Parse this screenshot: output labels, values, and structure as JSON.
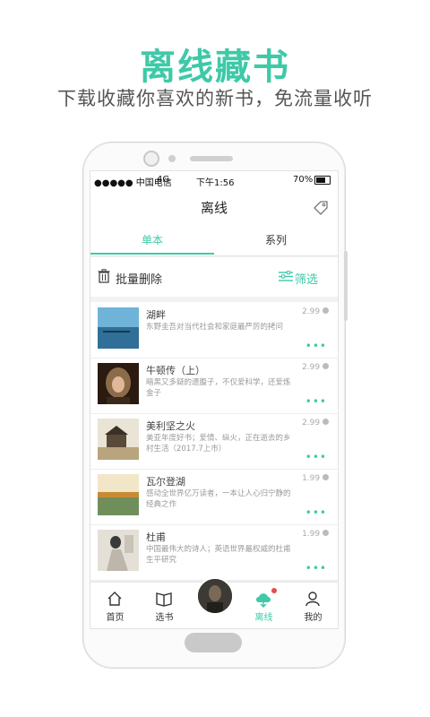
{
  "promo": {
    "title": "离线藏书",
    "subtitle": "下载收藏你喜欢的新书，免流量收听"
  },
  "status_bar": {
    "carrier": "●●●●● 中国电信",
    "network": "4G",
    "time": "下午1:56",
    "battery": "70%"
  },
  "app_bar": {
    "title": "离线",
    "tag_icon": "tag-icon"
  },
  "tabs": [
    {
      "label": "单本",
      "active": true
    },
    {
      "label": "系列",
      "active": false
    }
  ],
  "toolbar": {
    "batch_delete_label": "批量删除",
    "filter_label": "筛选"
  },
  "books": [
    {
      "title": "湖畔",
      "desc": "东野圭吾对当代社会和家庭最严厉的拷问",
      "price": "2.99"
    },
    {
      "title": "牛顿传（上）",
      "desc": "暗黑又多疑的遗腹子，不仅爱科学，还爱炼金子",
      "price": "2.99"
    },
    {
      "title": "美利坚之火",
      "desc": "美亚年度好书；爱情、纵火，正在逝去的乡村生活（2017.7上市）",
      "price": "2.99"
    },
    {
      "title": "瓦尔登湖",
      "desc": "感动全世界亿万读者，一本让人心归宁静的经典之作",
      "price": "1.99"
    },
    {
      "title": "杜甫",
      "desc": "中国最伟大的诗人；英语世界最权威的杜甫生平研究",
      "price": "1.99"
    }
  ],
  "bottom_nav": [
    {
      "label": "首页",
      "icon": "home-icon",
      "active": false
    },
    {
      "label": "选书",
      "icon": "book-icon",
      "active": false
    },
    {
      "label": "离线",
      "icon": "cloud-download-icon",
      "active": true
    },
    {
      "label": "我的",
      "icon": "user-icon",
      "active": false
    }
  ],
  "colors": {
    "accent": "#3ec9a7",
    "badge": "#e84b4b"
  }
}
